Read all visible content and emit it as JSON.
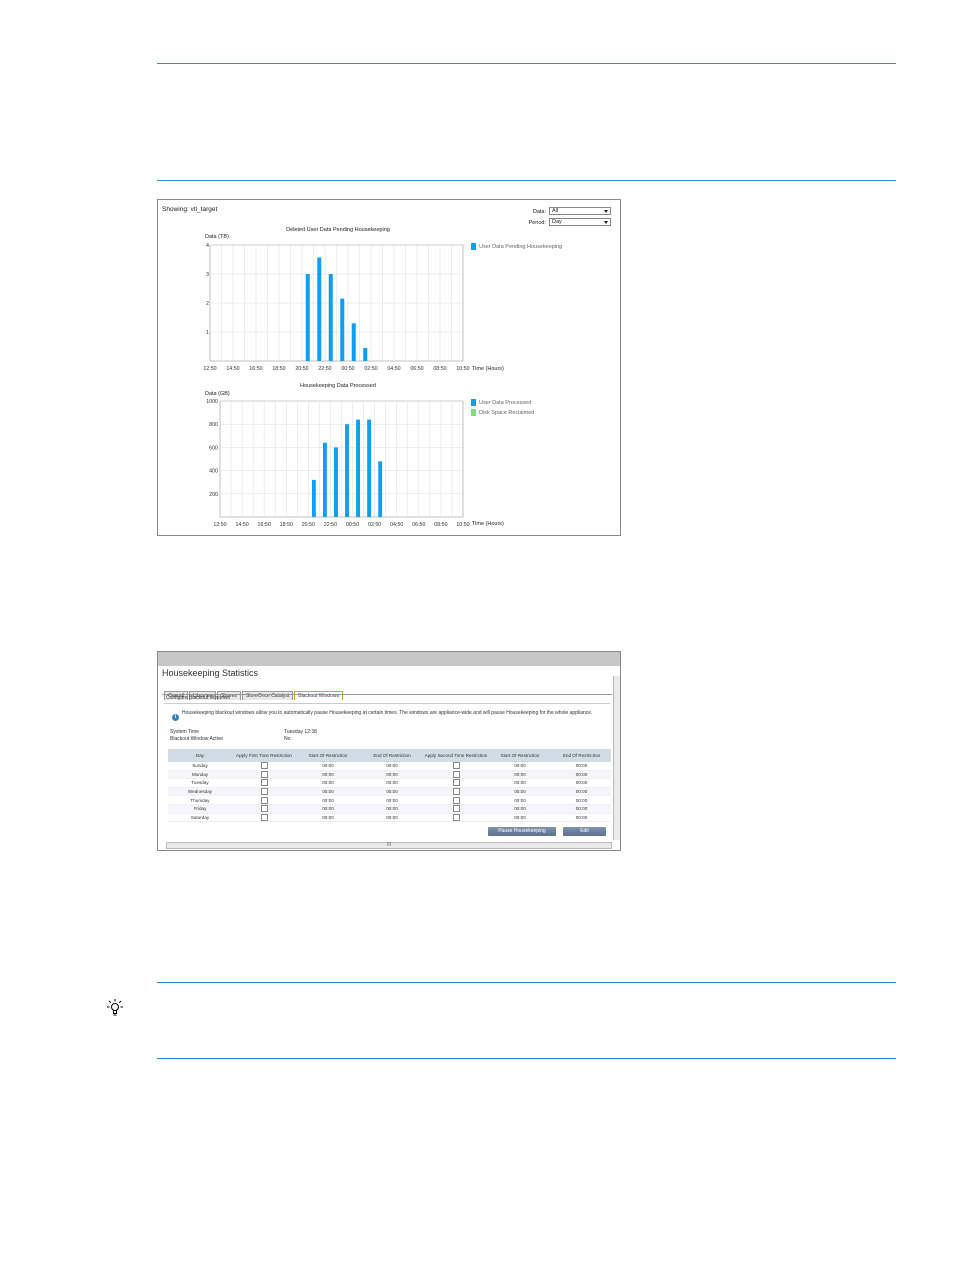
{
  "colors": {
    "rule": "#2a8fc4",
    "bar_blue": "#0f9ef0",
    "legend_green": "#7fe07a",
    "table_header": "#d3dbe4",
    "button": "#6a7f9c"
  },
  "chart_panel": {
    "showing": "Showing: vtl_target",
    "data_label": "Data:",
    "data_value": "All",
    "period_label": "Period:",
    "period_value": "Day"
  },
  "chart_data": [
    {
      "type": "bar",
      "title": "Deleted User Data Pending Housekeeping",
      "ylabel": "Data (TB)",
      "xlabel": "Time (Hours)",
      "x_tick_labels": [
        "12:50",
        "14:50",
        "16:50",
        "18:50",
        "20:50",
        "22:50",
        "00:50",
        "02:50",
        "04:50",
        "06:50",
        "08:50",
        "10:50"
      ],
      "y_tick_labels": [
        "1",
        "2",
        "3",
        "4"
      ],
      "ylim": [
        0,
        4
      ],
      "grid": true,
      "legend_position": "right",
      "series": [
        {
          "name": "User Data Pending Housekeeping",
          "color": "#0f9ef0",
          "points": [
            {
              "x": 8.5,
              "y": 3.0
            },
            {
              "x": 9.5,
              "y": 3.57
            },
            {
              "x": 10.5,
              "y": 3.0
            },
            {
              "x": 11.5,
              "y": 2.15
            },
            {
              "x": 12.5,
              "y": 1.3
            },
            {
              "x": 13.5,
              "y": 0.45
            }
          ]
        }
      ]
    },
    {
      "type": "bar",
      "title": "Housekeeping Data Processed",
      "ylabel": "Data (GB)",
      "xlabel": "Time (Hours)",
      "x_tick_labels": [
        "12:50",
        "14:50",
        "16:50",
        "18:50",
        "20:50",
        "22:50",
        "00:50",
        "02:50",
        "04:50",
        "06:50",
        "08:50",
        "10:50"
      ],
      "y_tick_labels": [
        "200",
        "400",
        "600",
        "800",
        "1000"
      ],
      "ylim": [
        0,
        1000
      ],
      "grid": true,
      "legend_position": "right",
      "series": [
        {
          "name": "User Data Processed",
          "color": "#0f9ef0",
          "points": [
            {
              "x": 8.5,
              "y": 320
            },
            {
              "x": 9.5,
              "y": 640
            },
            {
              "x": 10.5,
              "y": 600
            },
            {
              "x": 11.5,
              "y": 800
            },
            {
              "x": 12.5,
              "y": 840
            },
            {
              "x": 13.5,
              "y": 840
            },
            {
              "x": 14.5,
              "y": 480
            }
          ]
        },
        {
          "name": "Disk Space Reclaimed",
          "color": "#7fe07a",
          "points": []
        }
      ]
    }
  ],
  "blackout_panel": {
    "title": "Housekeeping Statistics",
    "tabs": [
      "Overall",
      "Libraries",
      "Shares",
      "StoreOnce Catalyst",
      "Blackout Windows"
    ],
    "section": "Configure Blackout Windows",
    "info": "Housekeeping blackout windows allow you to automatically pause Housekeeping at certain times. The windows are appliance-wide and will pause Housekeeping for the whole appliance.",
    "system_time_label": "System Time",
    "system_time_value": "Tuesday 12:38",
    "blackout_active_label": "Blackout Window Active",
    "blackout_active_value": "No",
    "columns": [
      "Day",
      "Apply First Time Restriction",
      "Start Of Restriction",
      "End Of Restriction",
      "Apply Second Time Restriction",
      "Start Of Restriction",
      "End Of Restriction"
    ],
    "rows": [
      {
        "day": "Sunday",
        "s1": "00:00",
        "e1": "00:00",
        "s2": "00:00",
        "e2": "00:00"
      },
      {
        "day": "Monday",
        "s1": "00:00",
        "e1": "00:00",
        "s2": "00:00",
        "e2": "00:00"
      },
      {
        "day": "Tuesday",
        "s1": "00:00",
        "e1": "00:00",
        "s2": "00:00",
        "e2": "00:00"
      },
      {
        "day": "Wednesday",
        "s1": "00:00",
        "e1": "00:00",
        "s2": "00:00",
        "e2": "00:00"
      },
      {
        "day": "Thursday",
        "s1": "00:00",
        "e1": "00:00",
        "s2": "00:00",
        "e2": "00:00"
      },
      {
        "day": "Friday",
        "s1": "00:00",
        "e1": "00:00",
        "s2": "00:00",
        "e2": "00:00"
      },
      {
        "day": "Saturday",
        "s1": "00:00",
        "e1": "00:00",
        "s2": "00:00",
        "e2": "00:00"
      }
    ],
    "pause_button": "Pause Housekeeping",
    "edit_button": "Edit",
    "scroll_grip": "III"
  },
  "tip_icon": "lightbulb-icon"
}
